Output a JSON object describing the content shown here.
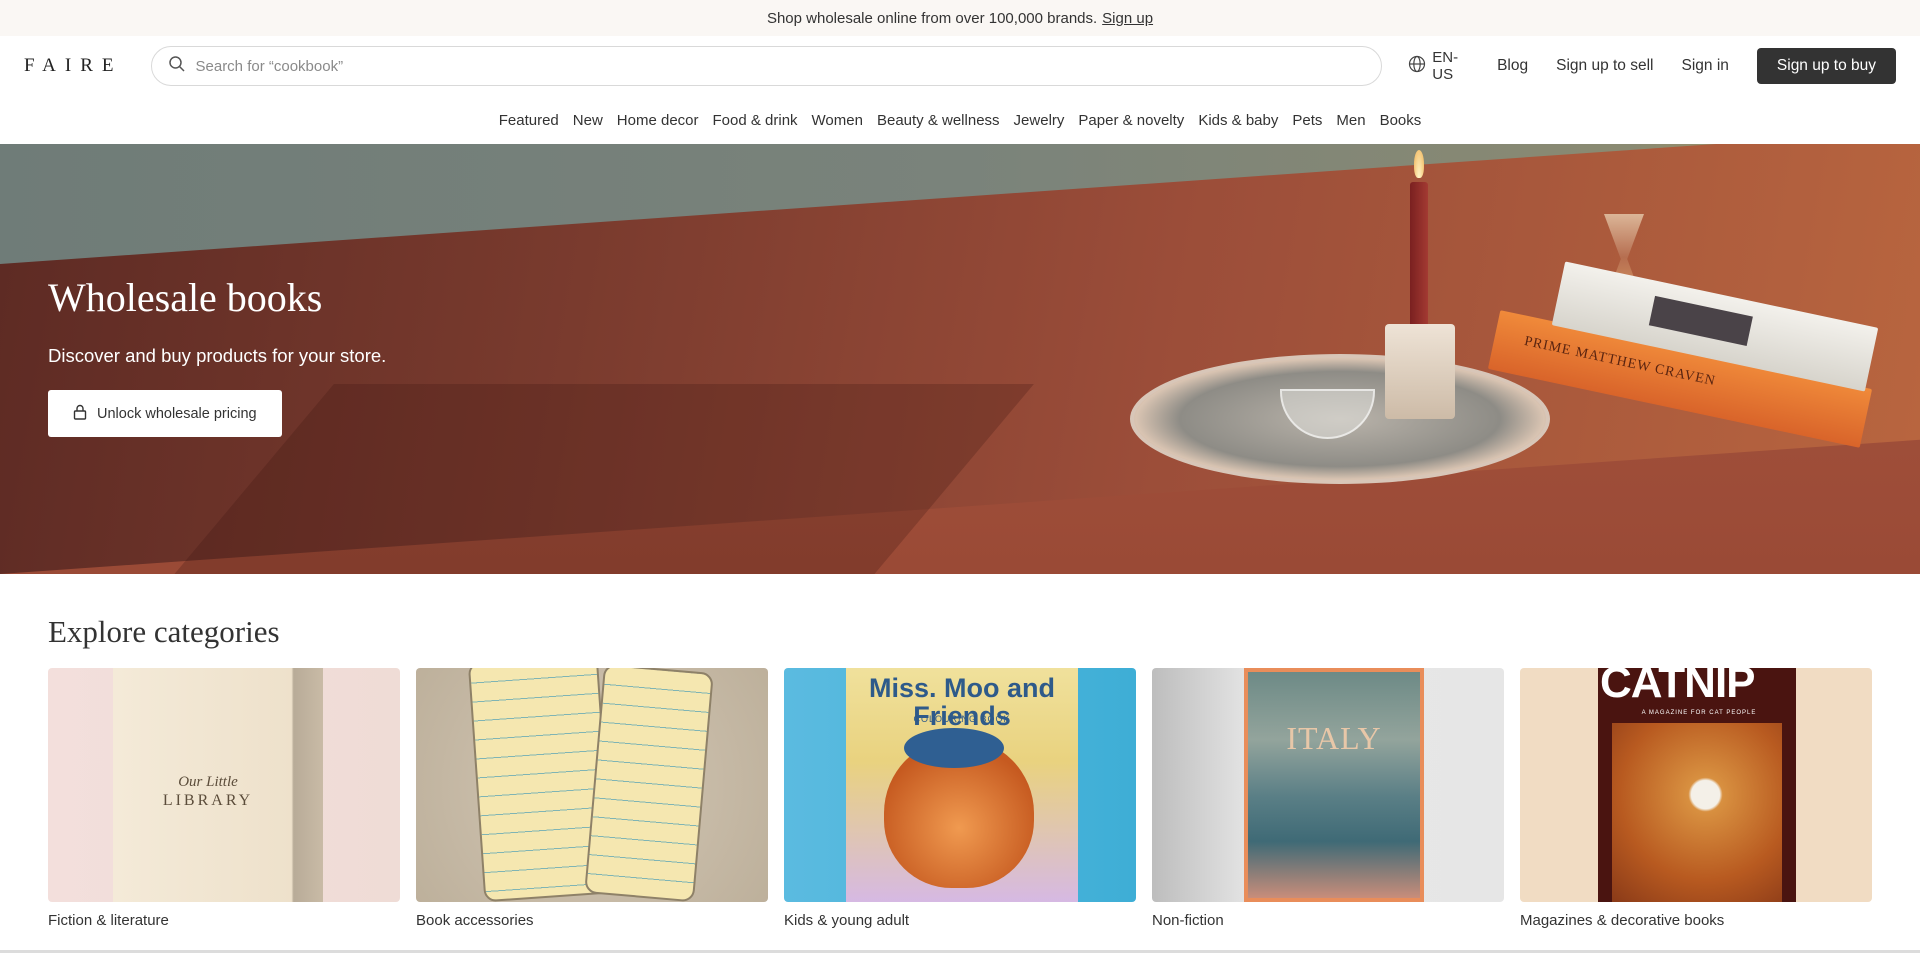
{
  "promo": {
    "text": "Shop wholesale online from over 100,000 brands.",
    "link": "Sign up"
  },
  "header": {
    "logo": "FAIRE",
    "search_placeholder": "Search for “cookbook”",
    "language": "EN-US",
    "blog": "Blog",
    "sign_up_sell": "Sign up to sell",
    "sign_in": "Sign in",
    "sign_up_buy": "Sign up to buy"
  },
  "categories_nav": [
    "Featured",
    "New",
    "Home decor",
    "Food & drink",
    "Women",
    "Beauty & wellness",
    "Jewelry",
    "Paper & novelty",
    "Kids & baby",
    "Pets",
    "Men",
    "Books"
  ],
  "hero": {
    "title": "Wholesale books",
    "subtitle": "Discover and buy products for your store.",
    "button": "Unlock wholesale pricing",
    "book_spine": "PRIME      MATTHEW CRAVEN"
  },
  "explore": {
    "title": "Explore categories",
    "cards": [
      {
        "label": "Fiction & literature",
        "cover_title_1": "Our Little",
        "cover_title_2": "LIBRARY"
      },
      {
        "label": "Book accessories"
      },
      {
        "label": "Kids & young adult",
        "cover_title_1": "Miss. Moo and Friends",
        "cover_title_2": "COLOURING BOOK"
      },
      {
        "label": "Non-fiction",
        "cover_title_1": "ITALY"
      },
      {
        "label": "Magazines & decorative books",
        "cover_title_1": "CATNIP",
        "cover_title_2": "A MAGAZINE FOR CAT PEOPLE"
      }
    ]
  },
  "colors": {
    "primary_button": "#333333",
    "promo_bg": "#faf7f4"
  }
}
